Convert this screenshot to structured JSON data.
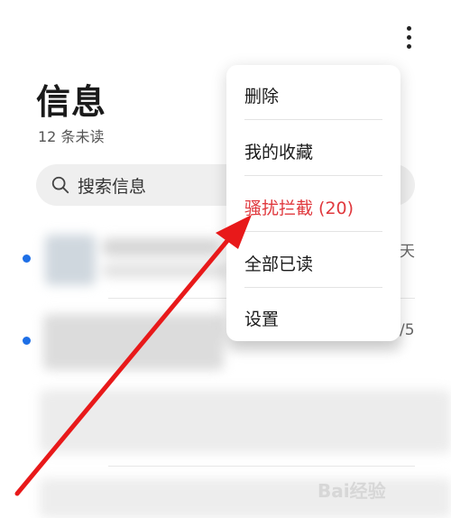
{
  "header": {
    "title": "信息",
    "unread": "12 条未读",
    "more_icon": "more-vertical-icon"
  },
  "search": {
    "placeholder": "搜索信息",
    "icon": "search-icon"
  },
  "list": {
    "row1_tail": "天",
    "row2_tail": "/5"
  },
  "menu": {
    "items": [
      {
        "label": "删除"
      },
      {
        "label": "我的收藏"
      },
      {
        "label": "骚扰拦截 (20)",
        "accent": true
      },
      {
        "label": "全部已读"
      },
      {
        "label": "设置"
      }
    ]
  },
  "colors": {
    "accent_red": "#e0393e",
    "unread_dot": "#1e6fe6",
    "annotation_arrow": "#e8191a"
  },
  "watermark": {
    "text": "Bai经验"
  }
}
